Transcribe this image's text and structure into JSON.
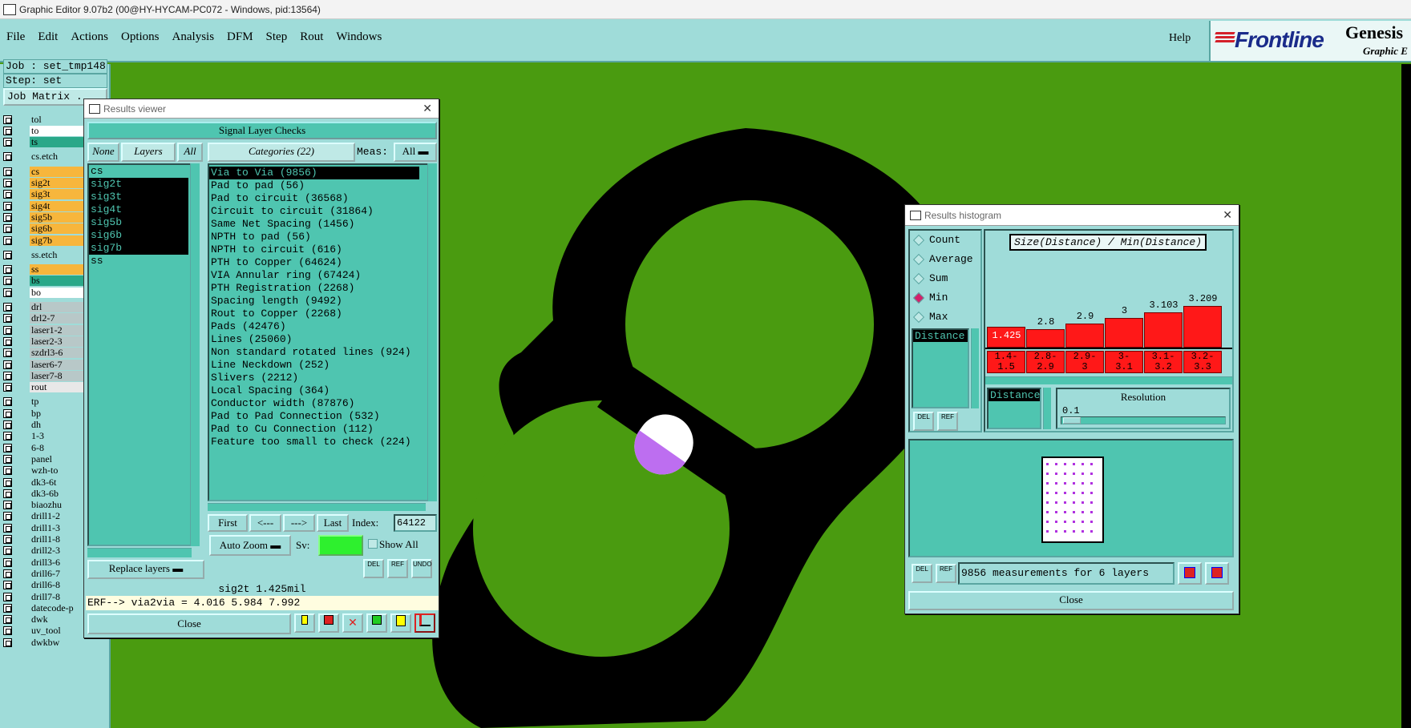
{
  "window": {
    "title": "Graphic Editor 9.07b2 (00@HY-HYCAM-PC072 - Windows, pid:13564)"
  },
  "menu": [
    "File",
    "Edit",
    "Actions",
    "Options",
    "Analysis",
    "DFM",
    "Step",
    "Rout",
    "Windows"
  ],
  "help_label": "Help",
  "brand": {
    "logo": "Frontline",
    "product": "Genesis",
    "subtitle": "Graphic E"
  },
  "left_panel": {
    "job": "Job : set_tmp148",
    "step": "Step: set",
    "job_matrix": "Job Matrix .",
    "layers": [
      {
        "name": "tol",
        "color": "#9fdcd9"
      },
      {
        "name": "to",
        "color": "#ffffff"
      },
      {
        "name": "ts",
        "color": "#2aa889"
      },
      {
        "name": "cs.etch",
        "color": "#9fdcd9"
      },
      {
        "name": "cs",
        "color": "#f7b63c"
      },
      {
        "name": "sig2t",
        "color": "#f7b63c"
      },
      {
        "name": "sig3t",
        "color": "#f7b63c"
      },
      {
        "name": "sig4t",
        "color": "#f7b63c"
      },
      {
        "name": "sig5b",
        "color": "#f7b63c"
      },
      {
        "name": "sig6b",
        "color": "#f7b63c"
      },
      {
        "name": "sig7b",
        "color": "#f7b63c"
      },
      {
        "name": "ss.etch",
        "color": "#9fdcd9"
      },
      {
        "name": "ss",
        "color": "#f7b63c"
      },
      {
        "name": "bs",
        "color": "#2aa889"
      },
      {
        "name": "bo",
        "color": "#ffffff"
      },
      {
        "name": "drl",
        "color": "#b8c8c8"
      },
      {
        "name": "drl2-7",
        "color": "#b8c8c8"
      },
      {
        "name": "laser1-2",
        "color": "#b8c8c8"
      },
      {
        "name": "laser2-3",
        "color": "#b8c8c8"
      },
      {
        "name": "szdrl3-6",
        "color": "#b8c8c8"
      },
      {
        "name": "laser6-7",
        "color": "#b8c8c8"
      },
      {
        "name": "laser7-8",
        "color": "#b8c8c8"
      },
      {
        "name": "rout",
        "color": "#e8e8e8"
      },
      {
        "name": "tp",
        "color": "#9fdcd9"
      },
      {
        "name": "bp",
        "color": "#9fdcd9"
      },
      {
        "name": "dh",
        "color": "#9fdcd9"
      },
      {
        "name": "1-3",
        "color": "#9fdcd9"
      },
      {
        "name": "6-8",
        "color": "#9fdcd9"
      },
      {
        "name": "panel",
        "color": "#9fdcd9"
      },
      {
        "name": "wzh-to",
        "color": "#9fdcd9"
      },
      {
        "name": "dk3-6t",
        "color": "#9fdcd9"
      },
      {
        "name": "dk3-6b",
        "color": "#9fdcd9"
      },
      {
        "name": "biaozhu",
        "color": "#9fdcd9"
      },
      {
        "name": "drill1-2",
        "color": "#9fdcd9"
      },
      {
        "name": "drill1-3",
        "color": "#9fdcd9"
      },
      {
        "name": "drill1-8",
        "color": "#9fdcd9"
      },
      {
        "name": "drill2-3",
        "color": "#9fdcd9"
      },
      {
        "name": "drill3-6",
        "color": "#9fdcd9"
      },
      {
        "name": "drill6-7",
        "color": "#9fdcd9"
      },
      {
        "name": "drill6-8",
        "color": "#9fdcd9"
      },
      {
        "name": "drill7-8",
        "color": "#9fdcd9"
      },
      {
        "name": "datecode-p",
        "color": "#9fdcd9"
      },
      {
        "name": "dwk",
        "color": "#9fdcd9"
      },
      {
        "name": "uv_tool",
        "color": "#9fdcd9"
      },
      {
        "name": "dwkbw",
        "color": "#9fdcd9"
      }
    ]
  },
  "results_viewer": {
    "title": "Results viewer",
    "header": "Signal Layer Checks",
    "none_btn": "None",
    "layers_btn": "Layers",
    "all_btn": "All",
    "categories_btn": "Categories (22)",
    "meas_label": "Meas:",
    "meas_value": "All",
    "layer_list": [
      {
        "name": "cs",
        "selected": false
      },
      {
        "name": "sig2t",
        "selected": true
      },
      {
        "name": "sig3t",
        "selected": true
      },
      {
        "name": "sig4t",
        "selected": true
      },
      {
        "name": "sig5b",
        "selected": true
      },
      {
        "name": "sig6b",
        "selected": true
      },
      {
        "name": "sig7b",
        "selected": true
      },
      {
        "name": "ss",
        "selected": false
      }
    ],
    "categories": [
      {
        "name": "Via to Via (9856)",
        "selected": true
      },
      {
        "name": "Pad to pad (56)",
        "selected": false
      },
      {
        "name": "Pad to circuit (36568)",
        "selected": false
      },
      {
        "name": "Circuit to circuit (31864)",
        "selected": false
      },
      {
        "name": "Same Net Spacing (1456)",
        "selected": false
      },
      {
        "name": "NPTH to pad (56)",
        "selected": false
      },
      {
        "name": "NPTH to circuit (616)",
        "selected": false
      },
      {
        "name": "PTH to Copper (64624)",
        "selected": false
      },
      {
        "name": "VIA Annular ring (67424)",
        "selected": false
      },
      {
        "name": "PTH Registration (2268)",
        "selected": false
      },
      {
        "name": "Spacing length (9492)",
        "selected": false
      },
      {
        "name": "Rout to Copper (2268)",
        "selected": false
      },
      {
        "name": "Pads (42476)",
        "selected": false
      },
      {
        "name": "Lines (25060)",
        "selected": false
      },
      {
        "name": "Non standard rotated lines (924)",
        "selected": false
      },
      {
        "name": "Line Neckdown (252)",
        "selected": false
      },
      {
        "name": "Slivers (2212)",
        "selected": false
      },
      {
        "name": "Local Spacing (364)",
        "selected": false
      },
      {
        "name": "Conductor width (87876)",
        "selected": false
      },
      {
        "name": "Pad to Pad Connection (532)",
        "selected": false
      },
      {
        "name": "Pad to Cu Connection (112)",
        "selected": false
      },
      {
        "name": "Feature too small to check (224)",
        "selected": false
      }
    ],
    "replace_layers": "Replace layers",
    "first_btn": "First",
    "prev_btn": "<---",
    "next_btn": "--->",
    "last_btn": "Last",
    "index_label": "Index:",
    "index_value": "64122",
    "autozoom": "Auto Zoom",
    "sv_label": "Sv:",
    "show_all": "Show All",
    "del_label": "DEL",
    "ref_label": "REF",
    "undo_label": "UNDO",
    "status": "sig2t 1.425mil",
    "erf": "ERF--> via2via = 4.016 5.984 7.992",
    "close": "Close"
  },
  "histogram": {
    "title": "Results histogram",
    "modes": [
      {
        "label": "Count",
        "on": false
      },
      {
        "label": "Average",
        "on": false
      },
      {
        "label": "Sum",
        "on": false
      },
      {
        "label": "Min",
        "on": true
      },
      {
        "label": "Max",
        "on": false
      }
    ],
    "chart_title": "Size(Distance) / Min(Distance)",
    "distance_label": "Distance",
    "bars": [
      {
        "value": "1.425",
        "range": "1.4-\n1.5"
      },
      {
        "value": "2.8",
        "range": "2.8-\n2.9"
      },
      {
        "value": "2.9",
        "range": "2.9-\n3"
      },
      {
        "value": "3",
        "range": "3-\n3.1"
      },
      {
        "value": "3.103",
        "range": "3.1-\n3.2"
      },
      {
        "value": "3.209",
        "range": "3.2-\n3.3"
      }
    ],
    "distance2": "Distance",
    "resolution_label": "Resolution",
    "resolution_value": "0.1",
    "del_label": "DEL",
    "ref_label": "REF",
    "measurements": "9856 measurements for 6 layers",
    "close": "Close"
  }
}
